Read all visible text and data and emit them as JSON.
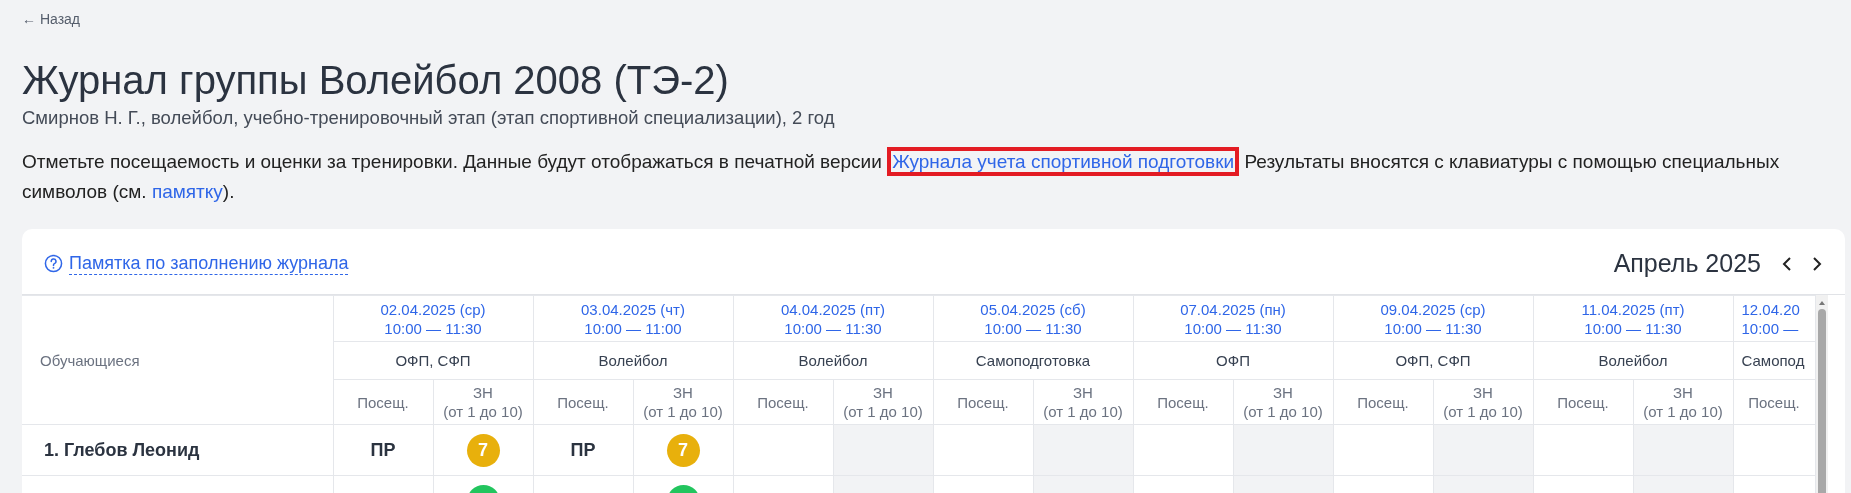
{
  "back_link": {
    "arrow": "←",
    "label": "Назад"
  },
  "title": "Журнал группы Волейбол 2008 (ТЭ-2)",
  "subtitle": "Смирнов Н. Г., волейбол, учебно-тренировочный этап (этап спортивной специализации), 2 год",
  "intro": {
    "before": "Отметьте посещаемость и оценки за тренировки. Данные будут отображаться в печатной версии ",
    "link": {
      "label": "Журнала учета спортивной подготовки",
      "highlighted": true
    },
    "middle": " Результаты вносятся с клавиатуры с помощью специальных символов (см. ",
    "link2": "памятку",
    "after": ")."
  },
  "card": {
    "help_link": "Памятка по заполнению журнала",
    "month": "Апрель 2025",
    "table": {
      "name_header": "Обучающиеся",
      "sessions": [
        {
          "date": "02.04.2025 (ср)",
          "time": "10:00 — 11:30",
          "topic": "ОФП, СФП",
          "attendance_header": "Посещ.",
          "grade_header": "ЗН\n(от 1 до 10)"
        },
        {
          "date": "03.04.2025 (чт)",
          "time": "10:00 — 11:00",
          "topic": "Волейбол",
          "attendance_header": "Посещ.",
          "grade_header": "ЗН\n(от 1 до 10)"
        },
        {
          "date": "04.04.2025 (пт)",
          "time": "10:00 — 11:30",
          "topic": "Волейбол",
          "attendance_header": "Посещ.",
          "grade_header": "ЗН\n(от 1 до 10)"
        },
        {
          "date": "05.04.2025 (сб)",
          "time": "10:00 — 11:30",
          "topic": "Самоподготовка",
          "attendance_header": "Посещ.",
          "grade_header": "ЗН\n(от 1 до 10)"
        },
        {
          "date": "07.04.2025 (пн)",
          "time": "10:00 — 11:30",
          "topic": "ОФП",
          "attendance_header": "Посещ.",
          "grade_header": "ЗН\n(от 1 до 10)"
        },
        {
          "date": "09.04.2025 (ср)",
          "time": "10:00 — 11:30",
          "topic": "ОФП, СФП",
          "attendance_header": "Посещ.",
          "grade_header": "ЗН\n(от 1 до 10)"
        },
        {
          "date": "11.04.2025 (пт)",
          "time": "10:00 — 11:30",
          "topic": "Волейбол",
          "attendance_header": "Посещ.",
          "grade_header": "ЗН\n(от 1 до 10)"
        },
        {
          "date": "12.04.20",
          "time": "10:00 —",
          "topic": "Самопод",
          "attendance_header": "Посещ.",
          "partial": true
        }
      ],
      "rows": [
        {
          "name": "1. Глебов Леонид",
          "cells": [
            {
              "attendance": "ПР",
              "grade": {
                "value": "7",
                "color": "#e8b00c"
              },
              "disabled": false
            },
            {
              "attendance": "ПР",
              "grade": {
                "value": "7",
                "color": "#e8b00c"
              },
              "disabled": false
            },
            {
              "disabled": true
            },
            {
              "disabled": true
            },
            {
              "disabled": true
            },
            {
              "disabled": true
            },
            {
              "disabled": true
            },
            {}
          ]
        },
        {
          "cells": [
            {
              "grade": {
                "color": "#22c55e"
              },
              "disabled": false
            },
            {
              "grade": {
                "color": "#22c55e"
              },
              "disabled": false
            },
            {
              "disabled": true
            },
            {
              "disabled": true
            },
            {
              "disabled": true
            },
            {
              "disabled": true
            },
            {
              "disabled": true
            },
            {}
          ]
        }
      ]
    }
  }
}
